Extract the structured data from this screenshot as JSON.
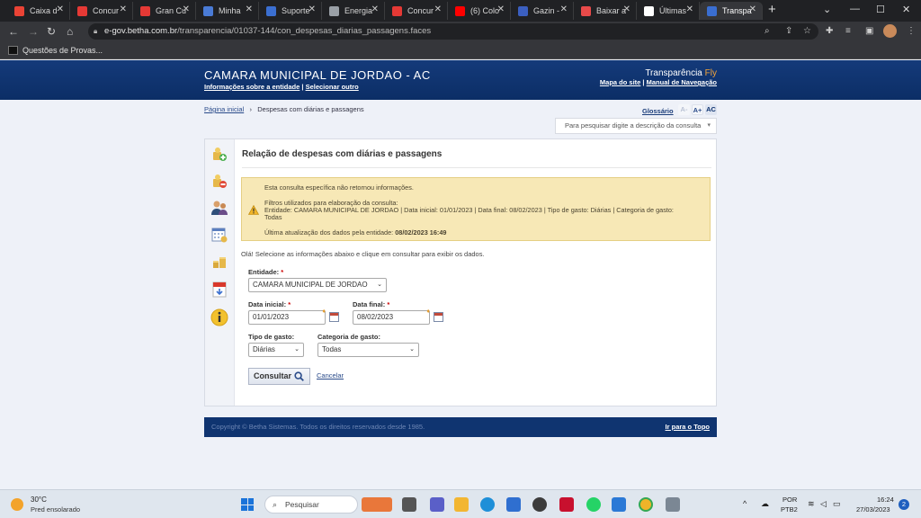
{
  "browser": {
    "tabs": [
      {
        "label": "Caixa d",
        "color": "#ea4335"
      },
      {
        "label": "Concur",
        "color": "#e53935"
      },
      {
        "label": "Gran Cu",
        "color": "#e53935"
      },
      {
        "label": "Minha",
        "color": "#4a7bd6"
      },
      {
        "label": "Suporte",
        "color": "#3b6fd1"
      },
      {
        "label": "Energia",
        "color": "#9aa0a6"
      },
      {
        "label": "Concur",
        "color": "#e53935"
      },
      {
        "label": "(6) Colo",
        "color": "#ff0000"
      },
      {
        "label": "Gazin -",
        "color": "#3b5fc0"
      },
      {
        "label": "Baixar a",
        "color": "#e84a4a"
      },
      {
        "label": "Últimas",
        "color": "#ffffff"
      },
      {
        "label": "Transpa",
        "color": "#3a6ed1"
      }
    ],
    "url_host": "e-gov.betha.com.br",
    "url_path": "/transparencia/01037-144/con_despesas_diarias_passagens.faces",
    "bookmark": "Questões de Provas..."
  },
  "site": {
    "title": "CAMARA MUNICIPAL DE JORDAO - AC",
    "link_info": "Informações sobre a entidade",
    "link_select": "Selecionar outro",
    "brand": "Transparência",
    "brand_fly": "Fly",
    "link_map": "Mapa do site",
    "link_manual": "Manual de Navegação"
  },
  "breadcrumb": {
    "home": "Página inicial",
    "current": "Despesas com diárias e passagens"
  },
  "tools": {
    "glossario": "Glossário",
    "font_small": "A-",
    "font_large": "A+",
    "contrast": "AC"
  },
  "search": {
    "placeholder": "Para pesquisar digite a descrição da consulta"
  },
  "content": {
    "title": "Relação de despesas com diárias e passagens",
    "alert": {
      "line1": "Esta consulta específica não retornou informações.",
      "line2": "Filtros utilizados para elaboração da consulta:",
      "line3": "Entidade: CAMARA MUNICIPAL DE JORDAO | Data inicial: 01/01/2023 | Data final: 08/02/2023 | Tipo de gasto: Diárias | Categoria de gasto:",
      "line4": "Todas",
      "line5_label": "Última atualização dos dados pela entidade:",
      "line5_value": "08/02/2023 16:49"
    },
    "intro": "Olá! Selecione as informações abaixo e clique em consultar para exibir os dados."
  },
  "form": {
    "entidade_label": "Entidade:",
    "entidade_value": "CAMARA MUNICIPAL DE JORDAO",
    "data_inicial_label": "Data inicial:",
    "data_inicial_value": "01/01/2023",
    "data_final_label": "Data final:",
    "data_final_value": "08/02/2023",
    "tipo_label": "Tipo de gasto:",
    "tipo_value": "Diárias",
    "categoria_label": "Categoria de gasto:",
    "categoria_value": "Todas",
    "required_mark": "*",
    "consultar": "Consultar",
    "cancelar": "Cancelar"
  },
  "footer": {
    "copyright": "Copyright © Betha Sistemas. Todos os direitos reservados desde 1985.",
    "top_link": "Ir para o Topo"
  },
  "taskbar": {
    "temp": "30°C",
    "weather": "Pred ensolarado",
    "search": "Pesquisar",
    "lang1": "POR",
    "lang2": "PTB2",
    "time": "16:24",
    "date": "27/03/2023",
    "notif": "2"
  }
}
